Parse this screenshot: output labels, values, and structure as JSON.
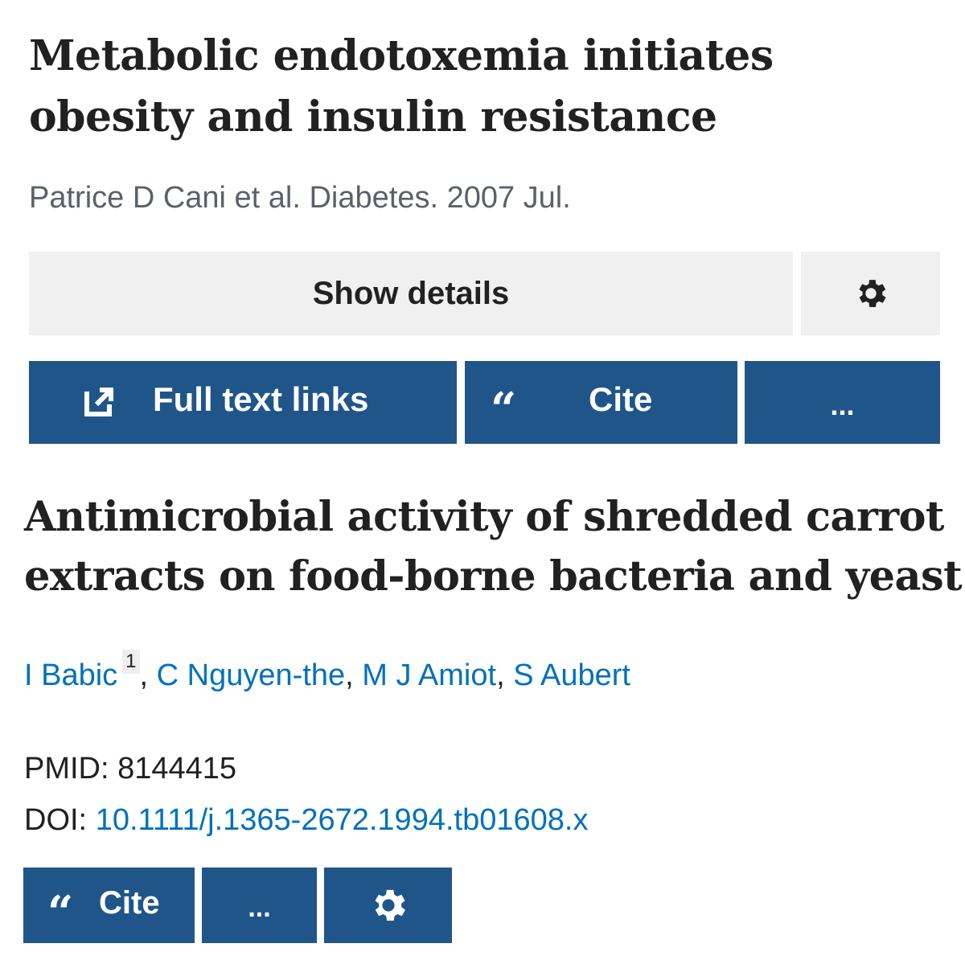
{
  "first_article": {
    "title": "Metabolic endotoxemia initiates obesity and insulin resistance",
    "citation": "Patrice D Cani et al. Diabetes. 2007 Jul.",
    "show_details_label": "Show details",
    "full_text_label": "Full text links",
    "cite_label": "Cite",
    "more_label": "...",
    "settings_icon": "gear-icon",
    "full_text_icon": "external-link-icon"
  },
  "second_article": {
    "title": "Antimicrobial activity of shredded carrot extracts on food-borne bacteria and yeast",
    "authors": [
      {
        "name": "I Babic",
        "affiliation": "1"
      },
      {
        "name": "C Nguyen-the"
      },
      {
        "name": "M J Amiot"
      },
      {
        "name": "S Aubert"
      }
    ],
    "separator": ", ",
    "pmid_label": "PMID: ",
    "pmid": "8144415",
    "doi_label": "DOI: ",
    "doi": "10.1111/j.1365-2672.1994.tb01608.x",
    "cite_label": "Cite",
    "more_label": "...",
    "settings_icon": "gear-icon"
  },
  "colors": {
    "primary_button": "#20558a",
    "link": "#0071bc",
    "secondary_button": "#f0f0f0",
    "muted_text": "#5b616b"
  }
}
